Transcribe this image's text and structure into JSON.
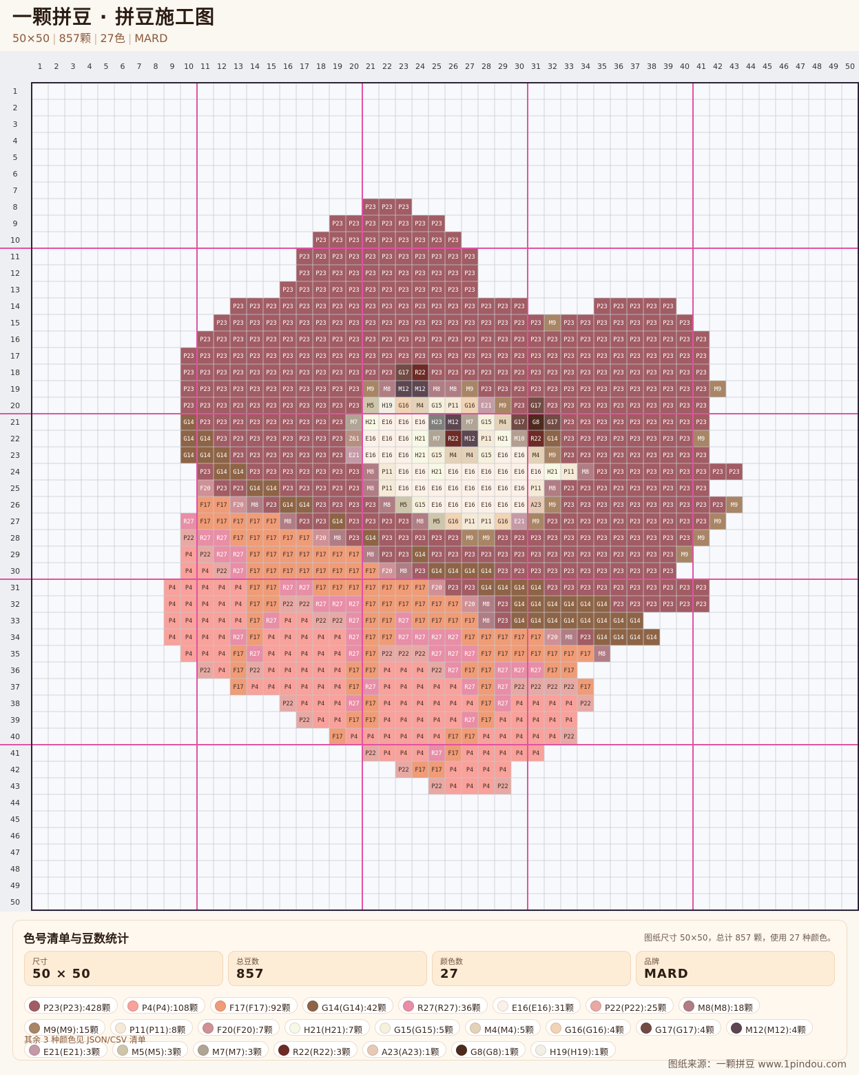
{
  "header": {
    "title": "一颗拼豆 · 拼豆施工图",
    "size": "50×50",
    "total": "857颗",
    "colors": "27色",
    "brand": "MARD"
  },
  "grid": {
    "cols": 50,
    "rows": 50,
    "rle": [
      [
        8,
        21,
        "P23 P23 P23"
      ],
      [
        9,
        19,
        "P23 P23 P23 P23 P23 P23 P23"
      ],
      [
        10,
        18,
        "P23*9"
      ],
      [
        11,
        17,
        "P23*11"
      ],
      [
        12,
        17,
        "P23*11"
      ],
      [
        13,
        16,
        "P23*12"
      ],
      [
        14,
        13,
        "P23*18"
      ],
      [
        14,
        35,
        "P23*5"
      ],
      [
        15,
        12,
        "P23*20 M9 P23*8"
      ],
      [
        16,
        11,
        "P23*31"
      ],
      [
        17,
        10,
        "P23*32"
      ],
      [
        18,
        10,
        "P23*13 G17 R22 P23*17"
      ],
      [
        19,
        10,
        "P23*11 M9 M8 M12 M12 M8 M8 M9 P23*14 M9"
      ],
      [
        20,
        10,
        "P23*11 M5 H19 G16 M4 G15 P11 G16 E21 M9 P23 G17 P23*10"
      ],
      [
        21,
        10,
        "G14 P23*9 M7 H21 E16 E16 E16 H23 M12 M7 G15 M4 G17 G8 G17 P23*9"
      ],
      [
        22,
        10,
        "G14 G14 P23*8 Z61 E16 E16 E16 H21 M7 R22 M12 P11 H21 M10 R22 G14 P23*8 M9"
      ],
      [
        23,
        10,
        "G14 G14 G14 P23*7 E21 E16 E16 E16 H21 G15 M4 M4 G15 E16 E16 M4 M9 P23*9"
      ],
      [
        24,
        11,
        "P23 G14 G14 P23*7 M8 P11 E16 E16 H21 E16 E16 E16 E16 E16 E16 H21 P11 M8 P23*9"
      ],
      [
        25,
        11,
        "F20 P23 P23 G14 G14 P23*5 M8 P11 E16 E16 E16 E16 E16 E16 E16 E16 P11 M8 P23*9"
      ],
      [
        26,
        11,
        "F17 F17 F20 M8 P23 G14 G14 P23*4 M8 M5 G15 E16 E16 E16 E16 E16 E16 A23 M9 P23*10 M9"
      ],
      [
        27,
        10,
        "R27 F17 F17 F17 F17 F17 M8 P23 P23 G14 P23*4 M8 M5 G16 P11 P11 G16 E21 M9 P23*10 M9"
      ],
      [
        28,
        10,
        "P22 R27 R27 F17 F17 F17 F17 F17 F20 M8 P23 G14 P23*5 M9 M9 P23*12 M9"
      ],
      [
        29,
        10,
        "P4 P22 R27 R27 F17 F17 F17 F17 F17 F17 F17 M8 P23 P23 G14 P23*15 M9"
      ],
      [
        30,
        10,
        "P4 P4 P22 R27 F17*8 F20 M8 P23 G14 G14 G14 G14 P23*11"
      ],
      [
        31,
        9,
        "P4*5 F17 F17 R27 R27 F17*7 F20 P23 P23 G14 G14 G14 G14 P23*10"
      ],
      [
        32,
        9,
        "P4*5 F17 F17 P22 P22 R27 R27 R27 F17*6 F20 M8 P23 G14*6 P23*6"
      ],
      [
        33,
        9,
        "P4*5 F17 R27 P4 P4 P22 P22 R27 F17 F17 R27 F17 F17 F17 F17 M8 P23 G14*8"
      ],
      [
        34,
        9,
        "P4*4 R27 F17 P4*5 R27 F17 F17 R27 R27 R27 R27 F17*5 F20 M8 P23 G14*4"
      ],
      [
        35,
        10,
        "P4 P4 P4 F17 R27 P4*5 R27 F17 P22 P22 P22 R27 R27 R27 F17*7 M8"
      ],
      [
        36,
        11,
        "P22 P4 F17 P22 P4*5 F17 F17 P4 P4 P4 P22 R27 F17 F17 R27 R27 R27 F17 F17"
      ],
      [
        37,
        13,
        "F17 P4*6 F17 R27 P4*5 R27 F17 R27 P22 P22 P22 P22 F17"
      ],
      [
        38,
        16,
        "P22 P4 P4 P4 R27 F17 P4*6 F17 R27 P4*4 P22"
      ],
      [
        39,
        17,
        "P22 P4 P4 F17 F17 P4*5 R27 F17 P4*5"
      ],
      [
        40,
        19,
        "F17 P4 P4*5 F17 F17 P4*5 P22"
      ],
      [
        41,
        21,
        "P22 P4 P4 P4 R27 F17 P4*5"
      ],
      [
        42,
        23,
        "P22 F17 F17 P4 P4 P4 P4"
      ],
      [
        43,
        25,
        "P22 P4 P4 P4 P22"
      ]
    ]
  },
  "legend": {
    "title": "色号清单与豆数统计",
    "note": "图纸尺寸 50×50，总计 857 颗，使用 27 种颜色。",
    "stats": [
      {
        "label": "尺寸",
        "value": "50 × 50"
      },
      {
        "label": "总豆数",
        "value": "857"
      },
      {
        "label": "颜色数",
        "value": "27"
      },
      {
        "label": "品牌",
        "value": "MARD"
      }
    ],
    "chips": [
      {
        "text": "P23(P23):428颗",
        "color": "#a15c64"
      },
      {
        "text": "P4(P4):108颗",
        "color": "#f9a19b"
      },
      {
        "text": "F17(F17):92颗",
        "color": "#ef9c77"
      },
      {
        "text": "G14(G14):42颗",
        "color": "#8e6446"
      },
      {
        "text": "R27(R27):36颗",
        "color": "#e88ea6"
      },
      {
        "text": "E16(E16):31颗",
        "color": "#fbf1e8"
      },
      {
        "text": "P22(P22):25颗",
        "color": "#e7a9a4"
      },
      {
        "text": "M8(M8):18颗",
        "color": "#b07d84"
      },
      {
        "text": "M9(M9):15颗",
        "color": "#a88565"
      },
      {
        "text": "P11(P11):8颗",
        "color": "#f4ead7"
      },
      {
        "text": "F20(F20):7颗",
        "color": "#cf9196"
      },
      {
        "text": "H21(H21):7颗",
        "color": "#f7f8e5"
      },
      {
        "text": "G15(G15):5颗",
        "color": "#f5f1dd"
      },
      {
        "text": "M4(M4):5颗",
        "color": "#e3d2b8"
      },
      {
        "text": "G16(G16):4颗",
        "color": "#f1d3b5"
      },
      {
        "text": "G17(G17):4颗",
        "color": "#714b44"
      },
      {
        "text": "M12(M12):4颗",
        "color": "#5c4650"
      },
      {
        "text": "E21(E21):3颗",
        "color": "#c49aa6"
      },
      {
        "text": "M5(M5):3颗",
        "color": "#cec6aa"
      },
      {
        "text": "M7(M7):3颗",
        "color": "#b0a495"
      },
      {
        "text": "R22(R22):3颗",
        "color": "#6d2b25"
      },
      {
        "text": "A23(A23):1颗",
        "color": "#e7cab6"
      },
      {
        "text": "G8(G8):1颗",
        "color": "#4d2a1d"
      },
      {
        "text": "H19(H19):1颗",
        "color": "#f2efe4"
      }
    ],
    "more": "其余 3 种颜色见 JSON/CSV 清单"
  },
  "colors": {
    "P23": "#a15c64",
    "P4": "#f9a19b",
    "F17": "#ef9c77",
    "G14": "#8e6446",
    "R27": "#e88ea6",
    "E16": "#fbf1e8",
    "P22": "#e7a9a4",
    "M8": "#b07d84",
    "M9": "#a88565",
    "P11": "#f4ead7",
    "F20": "#cf9196",
    "H21": "#f7f8e5",
    "G15": "#f5f1dd",
    "M4": "#e3d2b8",
    "G16": "#f1d3b5",
    "G17": "#714b44",
    "M12": "#5c4650",
    "E21": "#c49aa6",
    "M5": "#cec6aa",
    "M7": "#b0a495",
    "R22": "#6d2b25",
    "A23": "#e7cab6",
    "G8": "#4d2a1d",
    "H19": "#f2efe4",
    "H23": "#7f7f7c",
    "M10": "#b39e8f",
    "Z61": "#b78f80",
    "accent": "#e052a3",
    "frame": "#2b2236"
  },
  "footer": "图纸来源：一颗拼豆 www.1pindou.com"
}
